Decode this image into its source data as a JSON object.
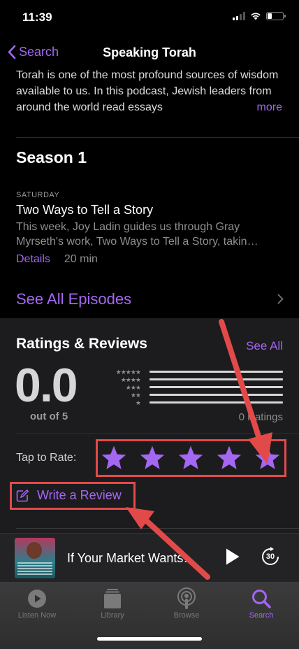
{
  "status": {
    "time": "11:39"
  },
  "nav": {
    "back_label": "Search",
    "title": "Speaking Torah"
  },
  "description": {
    "text": "Torah is one of the most profound sources of wisdom available to us. In this podcast, Jewish leaders from around the world read essays",
    "more_label": "more"
  },
  "season": {
    "title": "Season 1",
    "episode": {
      "day": "SATURDAY",
      "title": "Two Ways to Tell a Story",
      "description": "This week, Joy Ladin guides us through Gray Myrseth's work, Two Ways to Tell a Story, takin…",
      "details_label": "Details",
      "duration": "20 min"
    },
    "see_all_label": "See All Episodes"
  },
  "ratings": {
    "title": "Ratings & Reviews",
    "see_all_label": "See All",
    "score": "0.0",
    "out_of": "out of 5",
    "count_label": "0 Ratings",
    "tap_to_rate_label": "Tap to Rate:",
    "write_review_label": "Write a Review"
  },
  "mini_player": {
    "title": "If Your Market Wants…",
    "skip_seconds": "30"
  },
  "tabs": [
    {
      "label": "Listen Now",
      "icon": "play-circle-icon"
    },
    {
      "label": "Library",
      "icon": "library-stack-icon"
    },
    {
      "label": "Browse",
      "icon": "podcast-icon"
    },
    {
      "label": "Search",
      "icon": "search-icon",
      "active": true
    }
  ],
  "colors": {
    "accent": "#a467f2",
    "annotation": "#e24a4a",
    "background": "#000000"
  }
}
